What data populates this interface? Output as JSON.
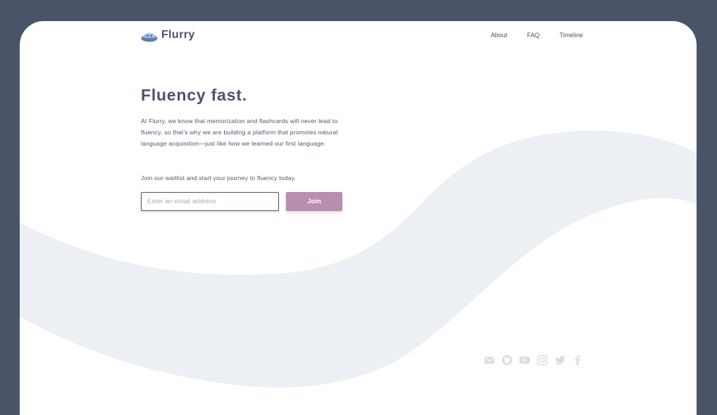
{
  "brand": {
    "name": "Flurry"
  },
  "nav": {
    "items": [
      "About",
      "FAQ",
      "Timeline"
    ]
  },
  "hero": {
    "title": "Fluency fast.",
    "description": "At Flurry, we know that memorization and flashcards will never lead to fluency, so that’s why we are building a platform that promotes natural language acquisition—just like how we learned our first language.",
    "waitlist_text": "Join our waitlist and start your journey to fluency today."
  },
  "signup": {
    "email_placeholder": "Enter an email address",
    "email_value": "",
    "join_label": "Join"
  },
  "socials": [
    "mail-icon",
    "github-icon",
    "youtube-icon",
    "instagram-icon",
    "twitter-icon",
    "facebook-icon"
  ],
  "colors": {
    "frame": "#4a5468",
    "page": "#ffffff",
    "text": "#4a5468",
    "wave": "#eceff3",
    "accent": "#b98daf",
    "social_icons": "#d9dee6"
  }
}
